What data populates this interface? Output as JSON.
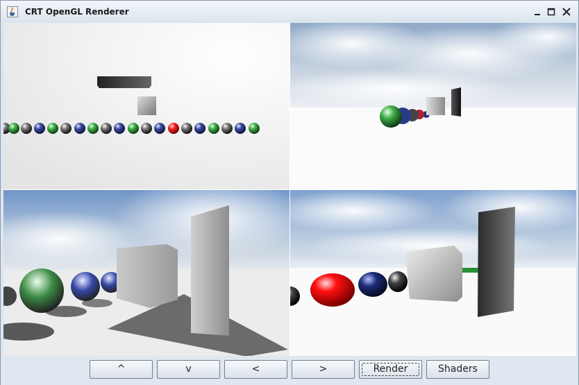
{
  "window": {
    "title": "CRT OpenGL Renderer"
  },
  "titlebar_icons": [
    "java-cup-icon",
    "minimize-icon",
    "maximize-icon",
    "close-icon"
  ],
  "viewports": [
    {
      "name": "top-orthographic-view"
    },
    {
      "name": "perspective-far-view"
    },
    {
      "name": "perspective-blurred-view"
    },
    {
      "name": "perspective-near-view"
    }
  ],
  "buttons": {
    "up": "^",
    "down": "v",
    "left": "<",
    "right": ">",
    "render": "Render",
    "shaders": "Shaders"
  },
  "colors": {
    "window_bg": "#dde5ee",
    "sky": "#9fb8d4",
    "red_ball": "#ff1010",
    "blue_ball": "#1b2d78",
    "green_ball": "#2fa03a"
  }
}
